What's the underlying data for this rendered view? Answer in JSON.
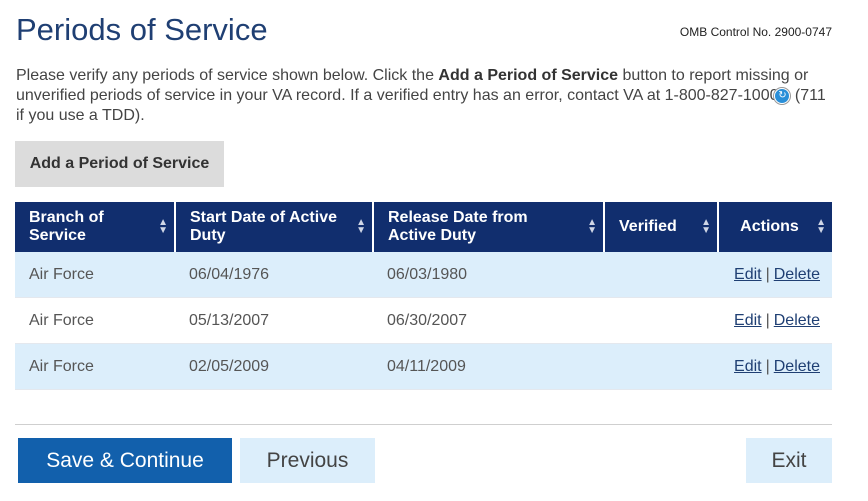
{
  "header": {
    "title": "Periods of Service",
    "omb": "OMB Control No. 2900-0747"
  },
  "intro": {
    "part1": "Please verify any periods of service shown below. Click the ",
    "bold": "Add a Period of Service",
    "part2": " button to report missing or unverified periods of service in your VA record. If a verified entry has an error, contact VA at 1-800-827-1000",
    "part3": " (711 if you use a TDD).",
    "phone_icon": "phone-call-icon"
  },
  "add_button": "Add a Period of Service",
  "table": {
    "headers": [
      "Branch of Service",
      "Start Date of Active Duty",
      "Release Date from Active Duty",
      "Verified",
      "Actions"
    ],
    "rows": [
      {
        "branch": "Air Force",
        "start": "06/04/1976",
        "release": "06/03/1980",
        "verified": "",
        "edit": "Edit",
        "delete": "Delete"
      },
      {
        "branch": "Air Force",
        "start": "05/13/2007",
        "release": "06/30/2007",
        "verified": "",
        "edit": "Edit",
        "delete": "Delete"
      },
      {
        "branch": "Air Force",
        "start": "02/05/2009",
        "release": "04/11/2009",
        "verified": "",
        "edit": "Edit",
        "delete": "Delete"
      }
    ],
    "separator": "|"
  },
  "footer": {
    "save": "Save & Continue",
    "previous": "Previous",
    "exit": "Exit"
  }
}
